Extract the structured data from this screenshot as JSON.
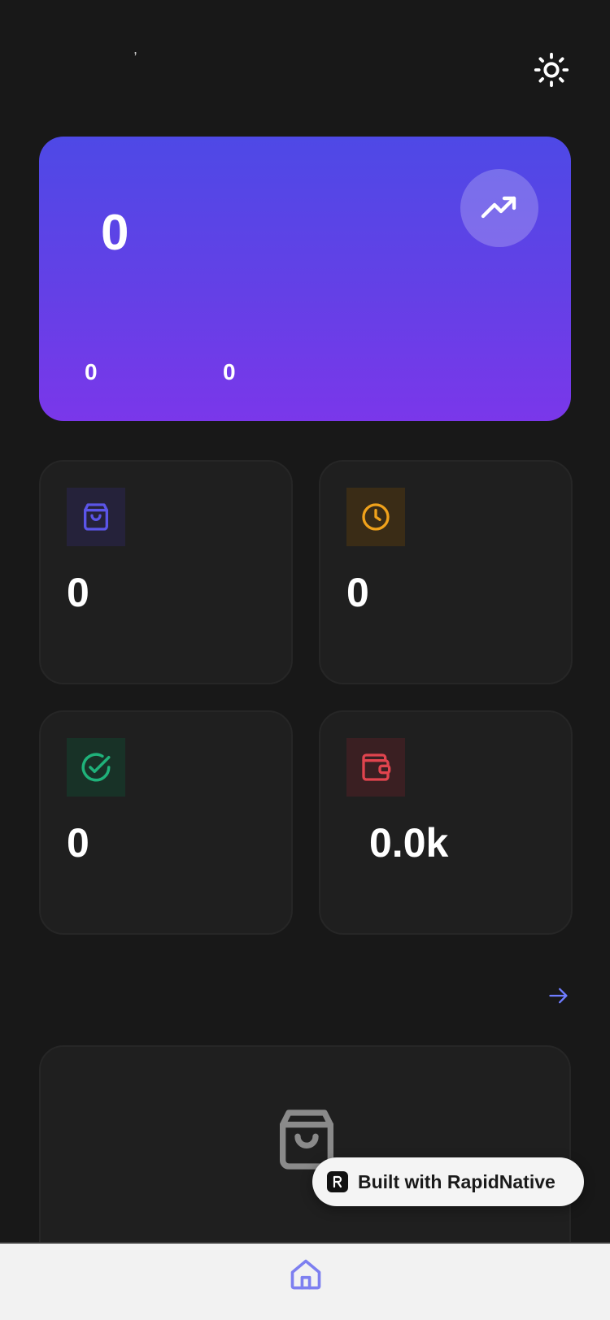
{
  "header": {
    "greeting": ",",
    "theme_toggle_icon": "sun-icon"
  },
  "hero": {
    "main_value": "0",
    "sub_value_1": "0",
    "sub_value_2": "0",
    "trend_icon": "trending-up-icon",
    "gradient_colors": [
      "#4e49e6",
      "#7a37ea"
    ]
  },
  "stats": [
    {
      "icon": "shopping-bag-icon",
      "value": "0",
      "accent": "#5b55e8",
      "bg": "#25223a"
    },
    {
      "icon": "clock-icon",
      "value": "0",
      "accent": "#f0a21b",
      "bg": "#3a2c16"
    },
    {
      "icon": "check-circle-icon",
      "value": "0",
      "accent": "#1fb27a",
      "bg": "#183227"
    },
    {
      "icon": "wallet-icon",
      "value": "0.0k",
      "accent": "#e0444e",
      "bg": "#3a1f22"
    }
  ],
  "section": {
    "see_all_icon": "arrow-right-icon",
    "arrow_color": "#6f7dff"
  },
  "empty_state": {
    "icon": "shopping-bag-icon"
  },
  "badge": {
    "label": "Built with RapidNative"
  },
  "tab_bar": {
    "home_icon": "home-icon",
    "active_color": "#7d7ff0"
  }
}
